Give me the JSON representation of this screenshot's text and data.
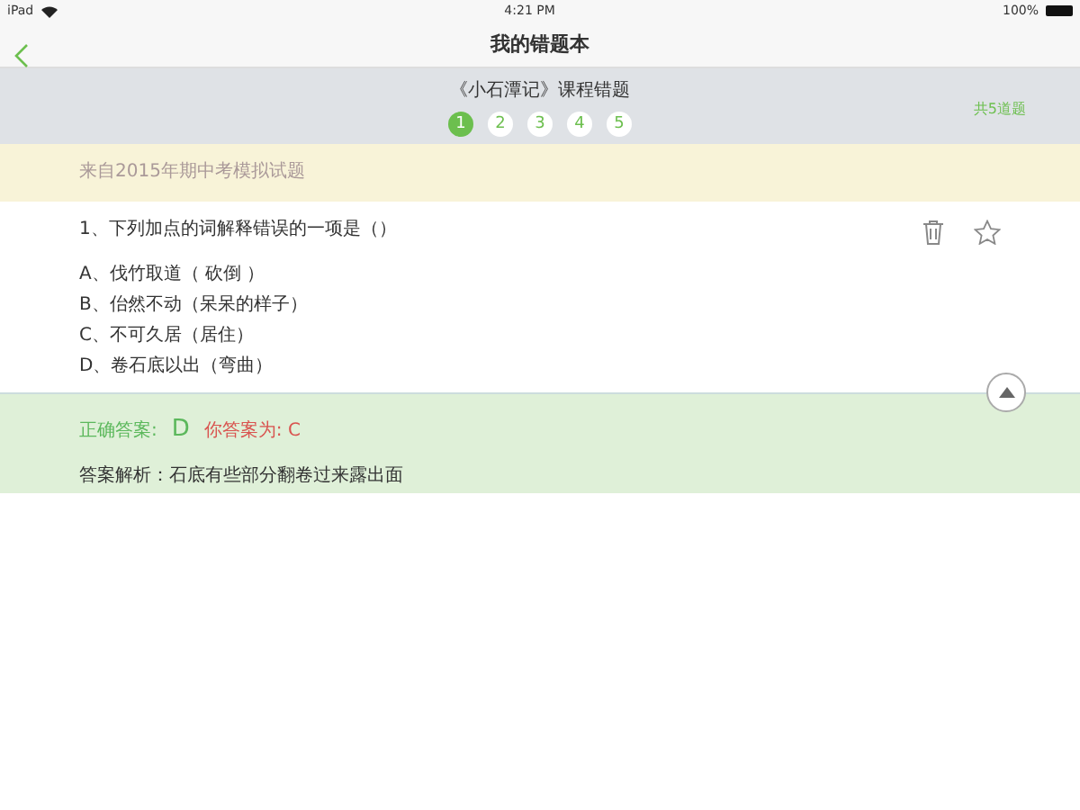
{
  "status_bar": {
    "device": "iPad",
    "time": "4:21 PM",
    "battery": "100%"
  },
  "nav": {
    "title": "我的错题本"
  },
  "course": {
    "title": "《小石潭记》课程错题",
    "total": "共5道题",
    "pages": [
      {
        "label": "1",
        "selected": true
      },
      {
        "label": "2",
        "selected": false
      },
      {
        "label": "3",
        "selected": false
      },
      {
        "label": "4",
        "selected": false
      },
      {
        "label": "5",
        "selected": false
      }
    ]
  },
  "source": "来自2015年期中考模拟试题",
  "question": {
    "text": "1、下列加点的词解释错误的一项是（）",
    "starred": false,
    "options": [
      "A、伐竹取道（ 砍倒 ）",
      "B、佁然不动（呆呆的样子）",
      "C、不可久居（居住）",
      "D、卷石底以出（弯曲）"
    ]
  },
  "answer": {
    "expanded": true,
    "correct_label": "正确答案:",
    "correct": "D",
    "yours": "你答案为: C",
    "analysis": "答案解析：石底有些部分翻卷过来露出面"
  }
}
